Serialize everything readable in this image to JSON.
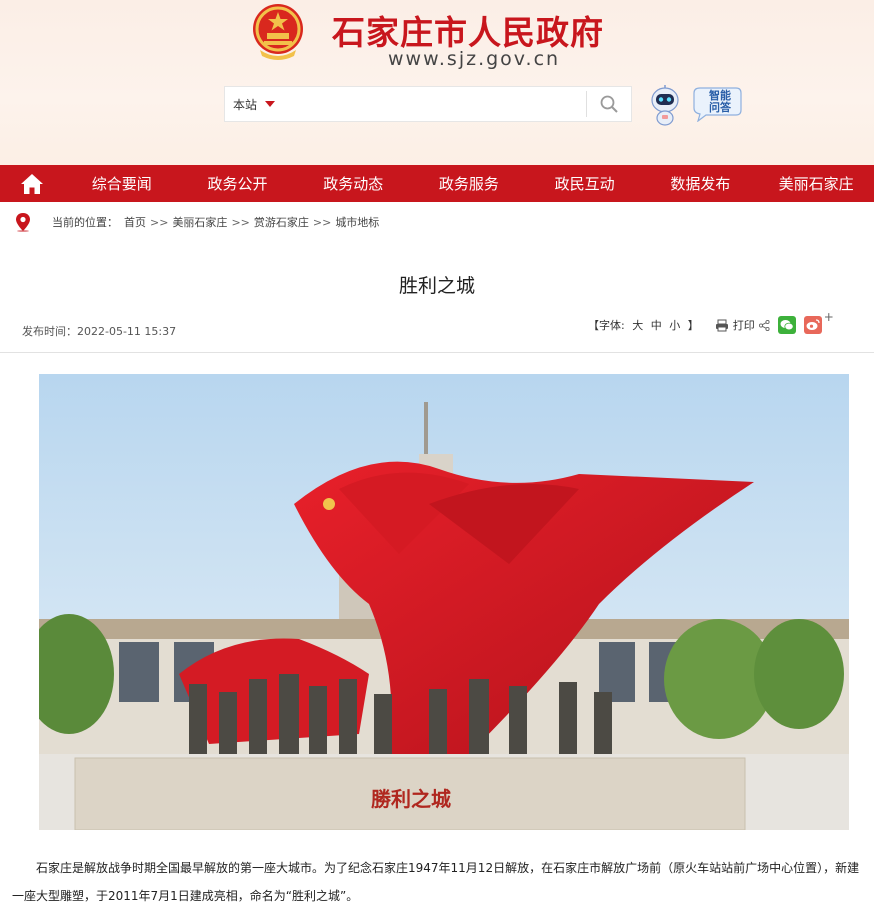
{
  "header": {
    "site_name": "石家庄市人民政府",
    "domain": "www.sjz.gov.cn",
    "search": {
      "scope": "本站",
      "placeholder": ""
    },
    "qa_label_line1": "智能",
    "qa_label_line2": "问答"
  },
  "nav": {
    "items": [
      "综合要闻",
      "政务公开",
      "政务动态",
      "政务服务",
      "政民互动",
      "数据发布",
      "美丽石家庄"
    ]
  },
  "breadcrumb": {
    "label": "当前的位置：",
    "items": [
      "首页",
      "美丽石家庄",
      "赏游石家庄",
      "城市地标"
    ],
    "separator": ">>"
  },
  "article": {
    "title": "胜利之城",
    "date_label": "发布时间：",
    "date": "2022-05-11 15:37",
    "font_size": {
      "prefix": "【字体:",
      "sizes": [
        "大",
        "中",
        "小"
      ],
      "suffix": "】"
    },
    "print_label": "打印",
    "statue_inscription": "勝利之城",
    "paragraph": "石家庄是解放战争时期全国最早解放的第一座大城市。为了纪念石家庄1947年11月12日解放，在石家庄市解放广场前（原火车站站前广场中心位置），新建一座大型雕塑，于2011年7月1日建成亮相，命名为“胜利之城”。"
  },
  "colors": {
    "brand_red": "#c8161d",
    "header_bg": "#fbeee6",
    "wechat": "#3db13b",
    "weibo": "#e8685a"
  }
}
